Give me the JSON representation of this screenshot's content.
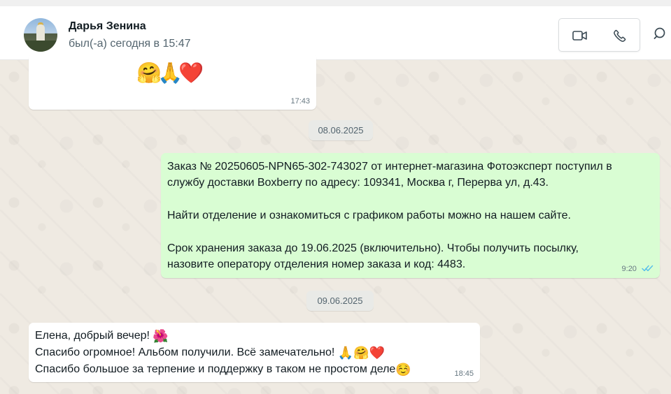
{
  "header": {
    "contact_name": "Дарья Зенина",
    "status": "был(-а) сегодня в 15:47",
    "actions": {
      "video": "video-camera-icon",
      "call": "phone-icon",
      "search": "search-icon"
    }
  },
  "chat": {
    "top_message": {
      "emojis": [
        "🤗",
        "🙏",
        "❤️"
      ],
      "time": "17:43"
    },
    "date_separator_1": "08.06.2025",
    "outgoing_message": {
      "lines": [
        "Заказ № 20250605-NPN65-302-743027 от интернет-магазина Фотоэксперт поступил в",
        "службу доставки Boxberry по адресу: 109341, Москва г, Перерва ул, д.43.",
        "",
        "Найти отделение и ознакомиться с графиком работы можно на нашем сайте.",
        "",
        "Срок хранения заказа до 19.06.2025 (включительно). Чтобы получить посылку,",
        "назовите оператору отделения номер заказа и код: 4483."
      ],
      "time": "9:20",
      "status": "read-double-check-icon"
    },
    "date_separator_2": "09.06.2025",
    "incoming_message": {
      "line_1": "Елена, добрый вечер! ",
      "line_1_emoji": "🌺",
      "line_2": "Спасибо огромное! Альбом получили. Всё замечательно! ",
      "line_2_emojis": "🙏🤗❤️",
      "line_3": "Спасибо большое за терпение и поддержку в таком не простом деле",
      "line_3_emoji": "☺️",
      "time": "18:45"
    }
  },
  "colors": {
    "chat_background": "#efeae2",
    "incoming_bubble": "#ffffff",
    "outgoing_bubble": "#d9fdd3",
    "read_ticks": "#53bdeb",
    "header_background": "#ffffff"
  }
}
